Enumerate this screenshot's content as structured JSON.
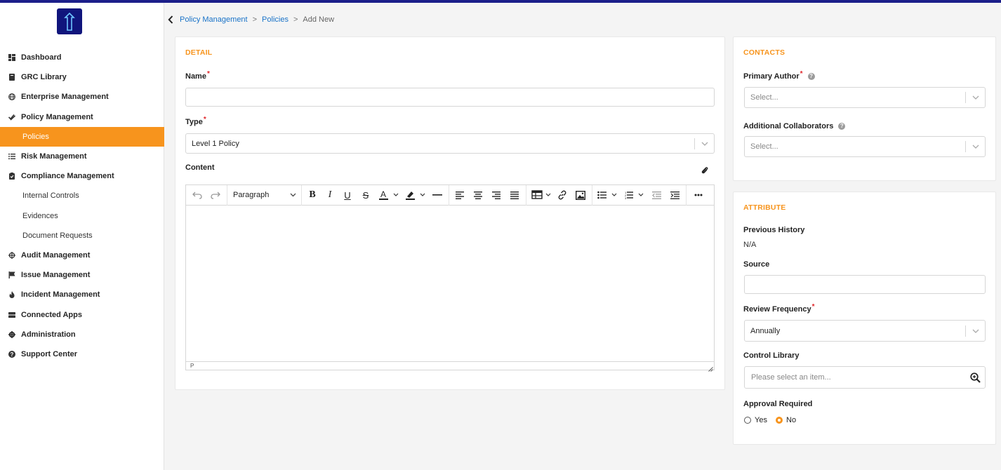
{
  "nav": {
    "items": [
      {
        "label": "Dashboard"
      },
      {
        "label": "GRC Library"
      },
      {
        "label": "Enterprise Management"
      },
      {
        "label": "Policy Management"
      },
      {
        "label": "Policies"
      },
      {
        "label": "Risk Management"
      },
      {
        "label": "Compliance Management"
      },
      {
        "label": "Internal Controls"
      },
      {
        "label": "Evidences"
      },
      {
        "label": "Document Requests"
      },
      {
        "label": "Audit Management"
      },
      {
        "label": "Issue Management"
      },
      {
        "label": "Incident Management"
      },
      {
        "label": "Connected Apps"
      },
      {
        "label": "Administration"
      },
      {
        "label": "Support Center"
      }
    ],
    "active": "Policies"
  },
  "breadcrumb": {
    "items": [
      "Policy Management",
      "Policies"
    ],
    "separator": ">",
    "current": "Add New"
  },
  "detail": {
    "title": "DETAIL",
    "name_label": "Name",
    "name_value": "",
    "type_label": "Type",
    "type_value": "Level 1 Policy",
    "content_label": "Content",
    "editor": {
      "block_format": "Paragraph",
      "status_path": "P"
    }
  },
  "contacts": {
    "title": "CONTACTS",
    "primary_author_label": "Primary Author",
    "primary_author_placeholder": "Select...",
    "collaborators_label": "Additional Collaborators",
    "collaborators_placeholder": "Select..."
  },
  "attribute": {
    "title": "ATTRIBUTE",
    "previous_history_label": "Previous History",
    "previous_history_value": "N/A",
    "source_label": "Source",
    "source_value": "",
    "review_frequency_label": "Review Frequency",
    "review_frequency_value": "Annually",
    "control_library_label": "Control Library",
    "control_library_placeholder": "Please select an item...",
    "approval_label": "Approval Required",
    "approval_options": [
      "Yes",
      "No"
    ],
    "approval_selected": "No"
  },
  "colors": {
    "accent": "#f7941d",
    "link": "#1a73c8",
    "brand": "#10157c",
    "required": "#e0262a"
  }
}
